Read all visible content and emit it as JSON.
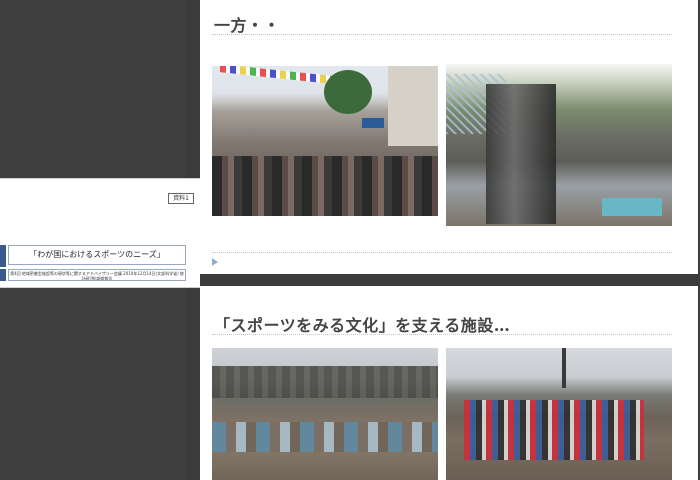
{
  "left_panel": {
    "doc_badge": "資料1",
    "doc_title": "「わが国におけるスポーツのニーズ」",
    "doc_subtitle": "第4回 地域密着型施設等の現状等に関するアドバイザリー会議 2010年12月14日(文部科学省) 統計研(独)調査報告"
  },
  "slides": [
    {
      "title": "一方・・",
      "photos": [
        {
          "name": "photo-festival-crowd"
        },
        {
          "name": "photo-spectators-net"
        }
      ]
    },
    {
      "title": "「スポーツをみる文化」を支える施設…",
      "photos": [
        {
          "name": "photo-park-picnic"
        },
        {
          "name": "photo-kids-game"
        }
      ]
    }
  ],
  "colors": {
    "background": "#3b3b3b",
    "slide_bg": "#ffffff",
    "accent": "#3a5a8c",
    "rule": "#b8c6d6"
  }
}
